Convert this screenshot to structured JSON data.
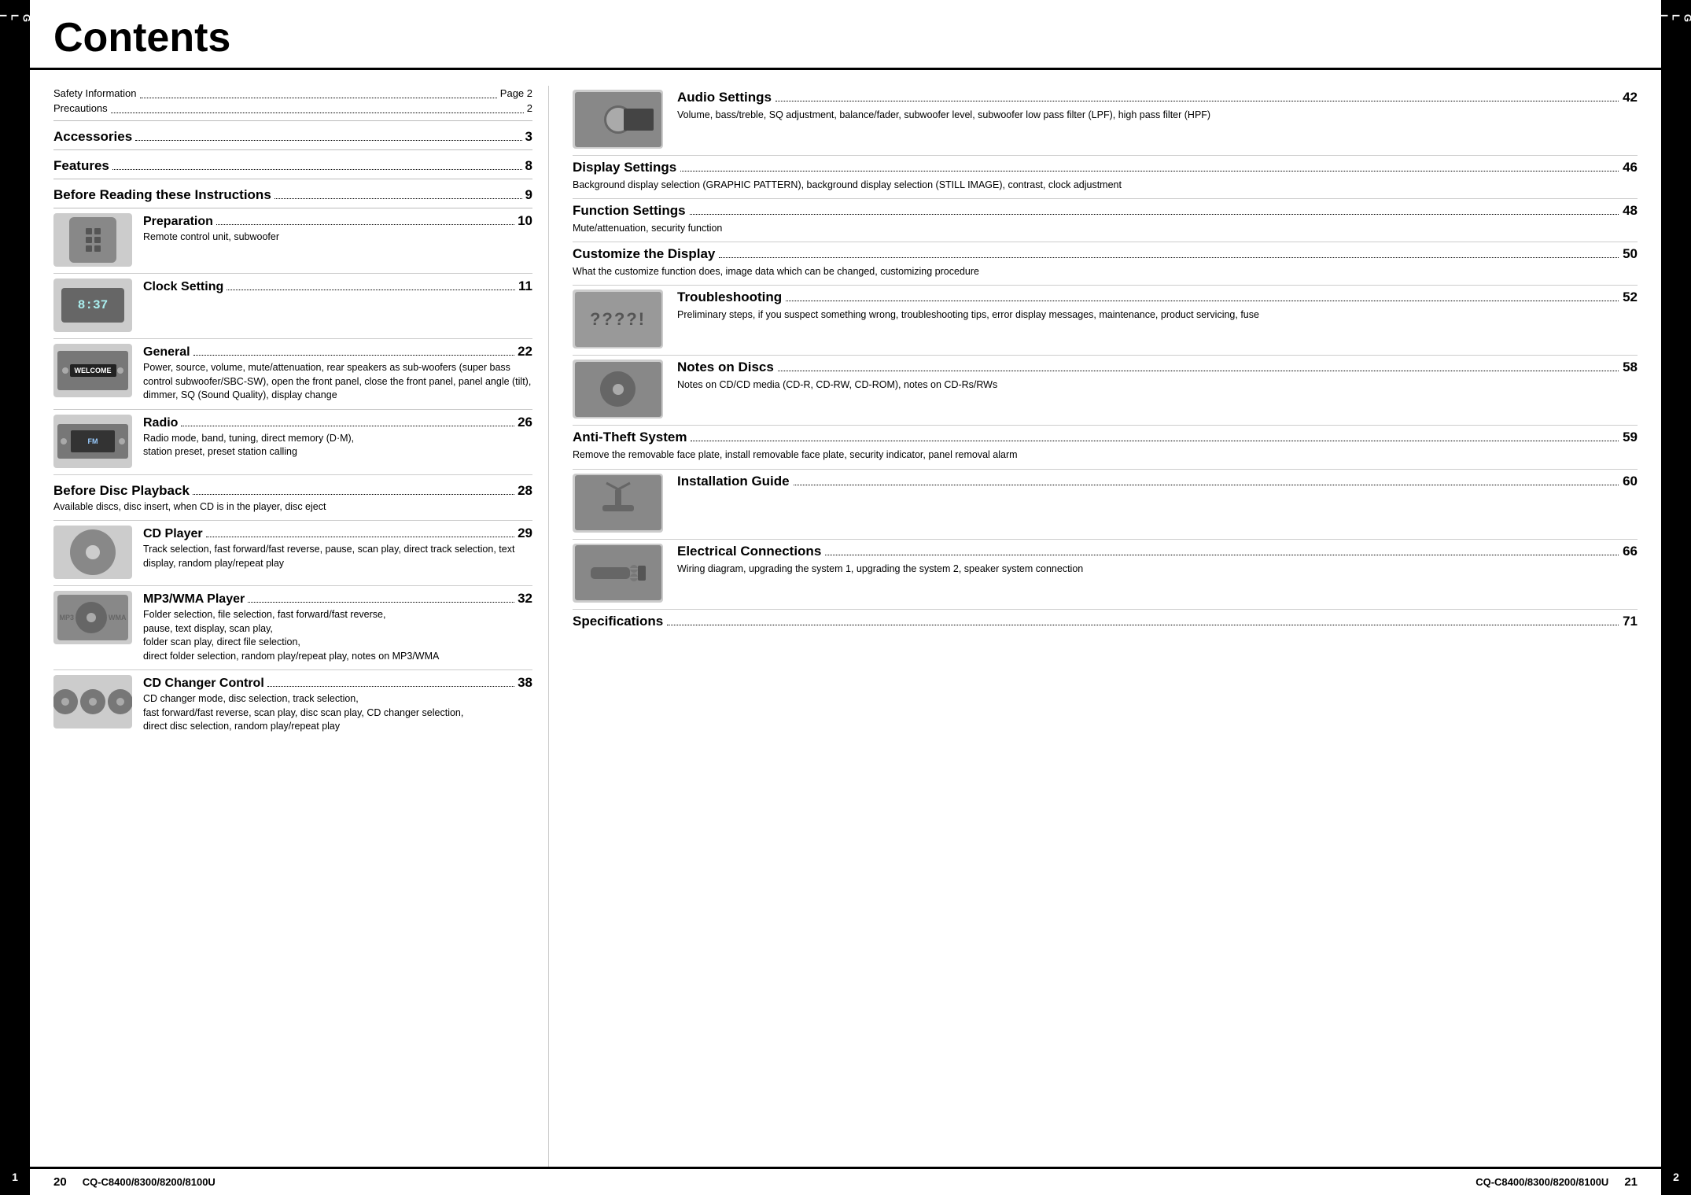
{
  "page": {
    "title": "Contents",
    "left_page_num": "20",
    "right_page_num": "21",
    "model": "CQ-C8400/8300/8200/8100U",
    "lang": "ENGLISH",
    "side_label": [
      "E",
      "N",
      "G",
      "L",
      "I",
      "S",
      "H"
    ],
    "left_num": "1",
    "right_num": "2"
  },
  "top_entries": [
    {
      "label": "Safety Information",
      "dots": true,
      "page": "Page 2"
    },
    {
      "label": "Precautions",
      "dots": true,
      "page": "2"
    }
  ],
  "left_sections": [
    {
      "title": "Accessories",
      "dots": true,
      "page": "3",
      "desc": "",
      "has_image": false
    },
    {
      "title": "Features",
      "dots": true,
      "page": "8",
      "desc": "",
      "has_image": false
    },
    {
      "title": "Before Reading these Instructions",
      "dots": true,
      "page": "9",
      "desc": "",
      "has_image": false
    },
    {
      "title": "Preparation",
      "dots": true,
      "page": "10",
      "desc": "Remote control unit, subwoofer",
      "has_image": true,
      "image_type": "remote"
    },
    {
      "title": "Clock Setting",
      "dots": true,
      "page": "11",
      "desc": "",
      "has_image": true,
      "image_type": "clock"
    },
    {
      "title": "General",
      "dots": true,
      "page": "22",
      "desc": "Power, source, volume, mute/attenuation, rear speakers as sub-woofers (super bass control subwoofer/SBC-SW), open the front panel, close the front panel, panel angle (tilt), dimmer, SQ (Sound Quality), display change",
      "has_image": true,
      "image_type": "welcome"
    },
    {
      "title": "Radio",
      "dots": true,
      "page": "26",
      "desc": "Radio mode, band, tuning, direct memory (D·M),\nstation preset, preset station calling",
      "has_image": true,
      "image_type": "radio"
    },
    {
      "title": "Before Disc Playback",
      "dots": true,
      "page": "28",
      "desc": "Available discs, disc insert, when CD is in the player, disc eject",
      "has_image": false
    },
    {
      "title": "CD Player",
      "dots": true,
      "page": "29",
      "desc": "Track selection, fast forward/fast reverse, pause, scan play, direct track selection, text display, random play/repeat play",
      "has_image": true,
      "image_type": "cd"
    },
    {
      "title": "MP3/WMA Player",
      "dots": true,
      "page": "32",
      "desc": "Folder selection, file selection, fast forward/fast reverse,\npause, text display, scan play,\nfolder scan play, direct file selection,\ndirect folder selection, random play/repeat play, notes on MP3/WMA",
      "has_image": true,
      "image_type": "mp3"
    },
    {
      "title": "CD Changer Control",
      "dots": true,
      "page": "38",
      "desc": "CD changer mode, disc selection, track selection,\nfast forward/fast reverse, scan play, disc scan play, CD changer selection,\ndirect disc selection, random play/repeat play",
      "has_image": true,
      "image_type": "changer"
    }
  ],
  "right_sections": [
    {
      "title": "Audio Settings",
      "dots": true,
      "page": "42",
      "desc": "Volume, bass/treble, SQ adjustment, balance/fader, subwoofer level, subwoofer low pass filter (LPF), high pass filter (HPF)",
      "has_image": true,
      "image_type": "audio"
    },
    {
      "title": "Display Settings",
      "dots": true,
      "page": "46",
      "desc": "Background display selection (GRAPHIC PATTERN), background display selection (STILL IMAGE), contrast, clock adjustment",
      "has_image": false
    },
    {
      "title": "Function Settings",
      "dots": true,
      "page": "48",
      "desc": "Mute/attenuation, security function",
      "has_image": false
    },
    {
      "title": "Customize the Display",
      "dots": true,
      "page": "50",
      "desc": "What the customize function does, image data which can be changed, customizing procedure",
      "has_image": false
    },
    {
      "title": "Troubleshooting",
      "dots": true,
      "page": "52",
      "desc": "Preliminary steps, if you suspect something wrong, troubleshooting tips, error display messages, maintenance, product servicing, fuse",
      "has_image": true,
      "image_type": "question"
    },
    {
      "title": "Notes on Discs",
      "dots": true,
      "page": "58",
      "desc": "Notes on CD/CD media (CD-R, CD-RW, CD-ROM), notes on CD-Rs/RWs",
      "has_image": true,
      "image_type": "disc"
    },
    {
      "title": "Anti-Theft System",
      "dots": true,
      "page": "59",
      "desc": "Remove the removable face plate, install removable face plate, security indicator, panel removal alarm",
      "has_image": false
    },
    {
      "title": "Installation Guide",
      "dots": true,
      "page": "60",
      "desc": "",
      "has_image": true,
      "image_type": "antenna"
    },
    {
      "title": "Electrical Connections",
      "dots": true,
      "page": "66",
      "desc": "Wiring diagram, upgrading the system 1, upgrading the system 2, speaker system connection",
      "has_image": true,
      "image_type": "wiring"
    },
    {
      "title": "Specifications",
      "dots": true,
      "page": "71",
      "desc": "",
      "has_image": false
    }
  ]
}
